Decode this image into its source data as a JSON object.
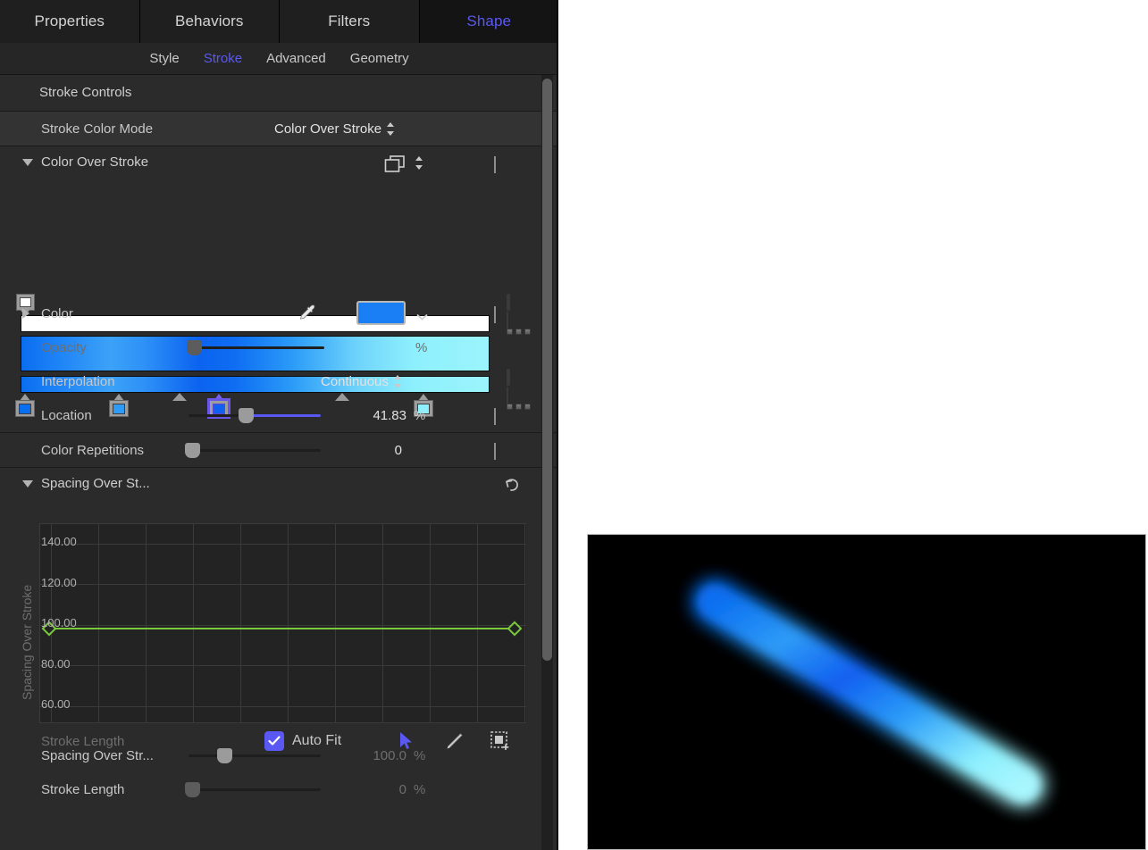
{
  "tabs": [
    {
      "label": "Properties",
      "active": false
    },
    {
      "label": "Behaviors",
      "active": false
    },
    {
      "label": "Filters",
      "active": false
    },
    {
      "label": "Shape",
      "active": true
    }
  ],
  "subtabs": [
    {
      "label": "Style",
      "active": false
    },
    {
      "label": "Stroke",
      "active": true
    },
    {
      "label": "Advanced",
      "active": false
    },
    {
      "label": "Geometry",
      "active": false
    }
  ],
  "stroke_controls": {
    "header": "Stroke Controls",
    "color_mode_label": "Stroke Color Mode",
    "color_mode_value": "Color Over Stroke"
  },
  "color_over_stroke": {
    "title": "Color Over Stroke",
    "gradient_stops": [
      {
        "position_pct": 0,
        "color": "#0a6ef0",
        "selected": false
      },
      {
        "position_pct": 21,
        "color": "#2e9bf7",
        "selected": false
      },
      {
        "position_pct": 42,
        "color": "#1160f0",
        "selected": true
      },
      {
        "position_pct": 86,
        "color": "#8ef0fd",
        "selected": false
      }
    ],
    "midpoints_pct": [
      36,
      71
    ],
    "opacity_tags": [
      {
        "position_pct": 0,
        "color": "#ffffff"
      }
    ]
  },
  "rows": {
    "color": {
      "label": "Color",
      "swatch": "#1a7ff5"
    },
    "opacity": {
      "label": "Opacity",
      "value": "",
      "unit": "%",
      "disabled": true,
      "slider_pct": 0
    },
    "interpolation": {
      "label": "Interpolation",
      "value": "Continuous"
    },
    "location": {
      "label": "Location",
      "value": "41.83",
      "unit": "%",
      "slider_pct": 41.83
    },
    "color_repetitions": {
      "label": "Color Repetitions",
      "value": "0",
      "unit": "",
      "slider_pct": 0
    }
  },
  "spacing_section": {
    "title": "Spacing Over St...",
    "revert_icon": "revert-arrow-icon"
  },
  "chart_data": {
    "type": "line",
    "title": "",
    "ylabel": "Spacing Over Stroke",
    "xlabel": "Stroke Length",
    "yticks": [
      140.0,
      120.0,
      100.0,
      80.0,
      60.0
    ],
    "ylim": [
      50,
      150
    ],
    "xlim": [
      0,
      100
    ],
    "grid": true,
    "series": [
      {
        "name": "Spacing Over Stroke",
        "color": "#7ac93a",
        "points": [
          {
            "x": 0,
            "y": 100
          },
          {
            "x": 100,
            "y": 100
          }
        ]
      }
    ]
  },
  "graph_footer": {
    "xaxis_label": "Stroke Length",
    "auto_fit_label": "Auto Fit",
    "auto_fit_checked": true,
    "tools": [
      {
        "name": "arrow-select-tool",
        "active": true
      },
      {
        "name": "pencil-draw-tool",
        "active": false
      },
      {
        "name": "marquee-add-tool",
        "active": false
      }
    ]
  },
  "bottom_rows": [
    {
      "label": "Spacing Over Str...",
      "value": "100.0",
      "unit": "%",
      "slider_pct": 16,
      "disabled": true
    },
    {
      "label": "Stroke Length",
      "value": "0",
      "unit": "%",
      "slider_pct": 0,
      "disabled": true
    }
  ],
  "canvas": {
    "name": "preview-canvas",
    "background": "#000000",
    "stroke_description": "glowing blue to cyan diagonal stroke"
  },
  "colors": {
    "accent": "#5a58f2",
    "panel_bg": "#2b2b2b",
    "row_alt": "#333333",
    "text": "#c8c8c8",
    "curve": "#7ac93a"
  }
}
